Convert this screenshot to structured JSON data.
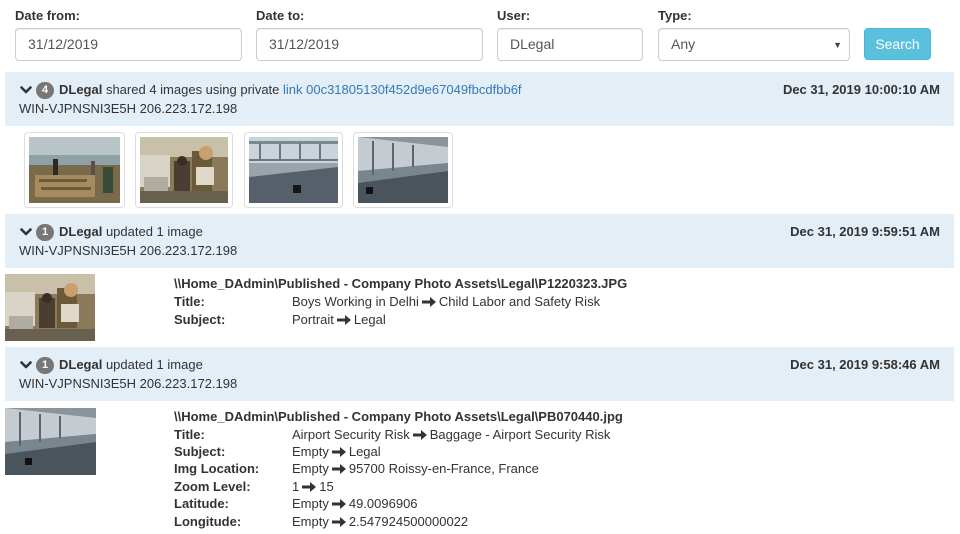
{
  "filters": {
    "date_from_label": "Date from:",
    "date_from_value": "31/12/2019",
    "date_to_label": "Date to:",
    "date_to_value": "31/12/2019",
    "user_label": "User:",
    "user_value": "DLegal",
    "type_label": "Type:",
    "type_value": "Any",
    "search_label": "Search"
  },
  "events": [
    {
      "count": "4",
      "user": "DLegal",
      "action": " shared 4 images using private ",
      "link_text": "link 00c31805130f452d9e67049fbcdfbb6f",
      "host": "WIN-VJPNSNI3E5H 206.223.172.198",
      "date": "Dec 31, 2019 10:00:10 AM",
      "thumbnails": [
        "boys-field-photo",
        "street-photo",
        "walkway-photo",
        "corridor-photo"
      ]
    },
    {
      "count": "1",
      "user": "DLegal",
      "action": " updated 1 image",
      "host": "WIN-VJPNSNI3E5H 206.223.172.198",
      "date": "Dec 31, 2019 9:59:51 AM",
      "path": "\\\\Home_DAdmin\\Published - Company Photo Assets\\Legal\\P1220323.JPG",
      "fields": [
        {
          "key": "Title:",
          "old": "Boys Working in Delhi",
          "new": "Child Labor and Safety Risk"
        },
        {
          "key": "Subject:",
          "old": "Portrait",
          "new": "Legal"
        }
      ]
    },
    {
      "count": "1",
      "user": "DLegal",
      "action": " updated 1 image",
      "host": "WIN-VJPNSNI3E5H 206.223.172.198",
      "date": "Dec 31, 2019 9:58:46 AM",
      "path": "\\\\Home_DAdmin\\Published - Company Photo Assets\\Legal\\PB070440.jpg",
      "fields": [
        {
          "key": "Title:",
          "old": "Airport Security Risk",
          "new": "Baggage - Airport Security Risk"
        },
        {
          "key": "Subject:",
          "old": "Empty",
          "new": "Legal"
        },
        {
          "key": "Img Location:",
          "old": "Empty",
          "new": "95700 Roissy-en-France, France"
        },
        {
          "key": "Zoom Level:",
          "old": "1",
          "new": "15"
        },
        {
          "key": "Latitude:",
          "old": "Empty",
          "new": "49.0096906"
        },
        {
          "key": "Longitude:",
          "old": "Empty",
          "new": "2.547924500000022"
        }
      ]
    }
  ],
  "icons": {
    "chevron": "chevron-down-icon",
    "arrow": "arrow-right-icon",
    "caret": "caret-down-icon"
  },
  "colors": {
    "header_bg": "#e4eef7",
    "badge": "#777777",
    "link": "#337ab7",
    "search_button": "#5bc0de"
  }
}
